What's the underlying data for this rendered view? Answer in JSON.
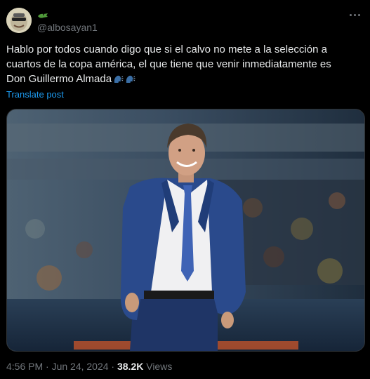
{
  "tweet": {
    "handle": "@albosayan1",
    "text_line1": "Hablo por todos cuando digo que si el calvo no mete a la selección a",
    "text_line2": "cuartos de la copa américa, el que tiene que venir inmediatamente es",
    "text_line3": "Don Guillermo Almada",
    "translate_label": "Translate post",
    "time": "4:56 PM · Jun 24, 2024 · ",
    "views_count": "38.2K",
    "views_label": " Views"
  },
  "icons": {
    "avatar": "avatar-image",
    "name_emoji": "crocodile-icon",
    "more": "more-horizontal-icon",
    "speaking_head_1": "speaking-head-icon",
    "speaking_head_2": "speaking-head-icon"
  },
  "colors": {
    "background": "#000000",
    "text": "#e7e9ea",
    "muted": "#71767b",
    "link": "#1d9bf0",
    "border": "#2f3336"
  }
}
